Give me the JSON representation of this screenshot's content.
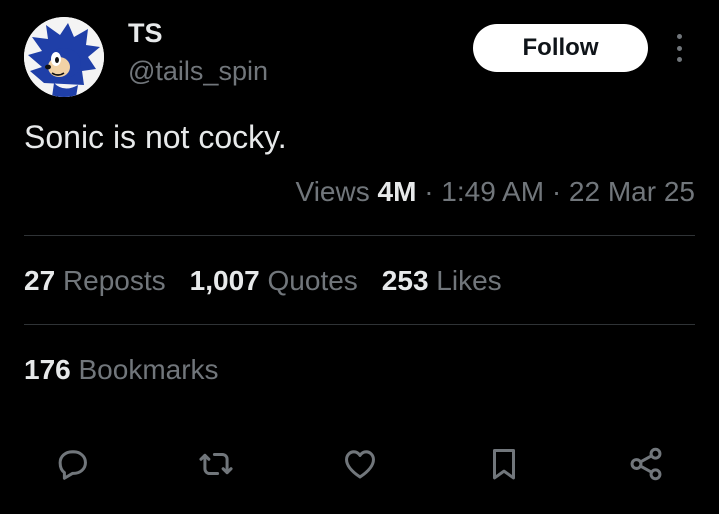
{
  "author": {
    "display_name": "TS",
    "handle": "@tails_spin",
    "avatar_icon": "sonic-avatar-icon"
  },
  "follow_label": "Follow",
  "more_icon": "more-vertical-icon",
  "tweet": {
    "text": "Sonic is not cocky."
  },
  "meta": {
    "views_label": "Views",
    "views_count": "4M",
    "separator": "·",
    "time": "1:49 AM",
    "date": "22 Mar 25"
  },
  "stats": {
    "reposts_count": "27",
    "reposts_label": "Reposts",
    "quotes_count": "1,007",
    "quotes_label": "Quotes",
    "likes_count": "253",
    "likes_label": "Likes",
    "bookmarks_count": "176",
    "bookmarks_label": "Bookmarks"
  },
  "actions": {
    "reply_icon": "reply-icon",
    "repost_icon": "repost-icon",
    "like_icon": "like-icon",
    "bookmark_icon": "bookmark-icon",
    "share_icon": "share-icon"
  },
  "colors": {
    "background": "#000000",
    "text_primary": "#e7e9ea",
    "text_secondary": "#71767b",
    "divider": "#2f3336",
    "follow_bg": "#ffffff",
    "avatar_blue": "#1f3fa8"
  }
}
